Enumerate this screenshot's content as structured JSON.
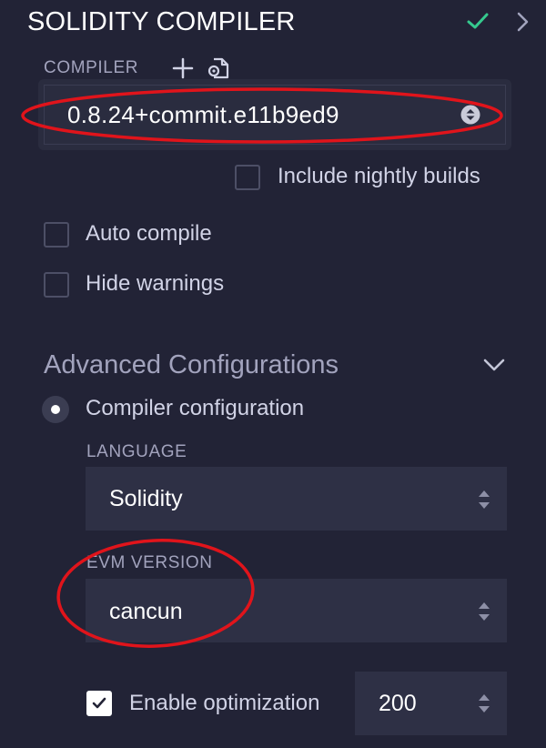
{
  "panel": {
    "title": "SOLIDITY COMPILER"
  },
  "compiler": {
    "label": "COMPILER",
    "version": "0.8.24+commit.e11b9ed9",
    "include_nightly_label": "Include nightly builds",
    "include_nightly_checked": false
  },
  "options": {
    "auto_compile_label": "Auto compile",
    "auto_compile_checked": false,
    "hide_warnings_label": "Hide warnings",
    "hide_warnings_checked": false
  },
  "advanced": {
    "title": "Advanced Configurations",
    "mode_label": "Compiler configuration",
    "language_label": "LANGUAGE",
    "language_value": "Solidity",
    "evm_label": "EVM VERSION",
    "evm_value": "cancun",
    "optimization_label": "Enable optimization",
    "optimization_checked": true,
    "runs_value": "200"
  },
  "colors": {
    "background": "#222336",
    "status_ok": "#35c98e",
    "annotation": "#e0141b"
  },
  "icons": {
    "status": "check-icon",
    "expand": "chevron-right-icon",
    "add": "plus-icon",
    "load_config": "file-settings-icon",
    "collapse": "chevron-down-icon"
  }
}
